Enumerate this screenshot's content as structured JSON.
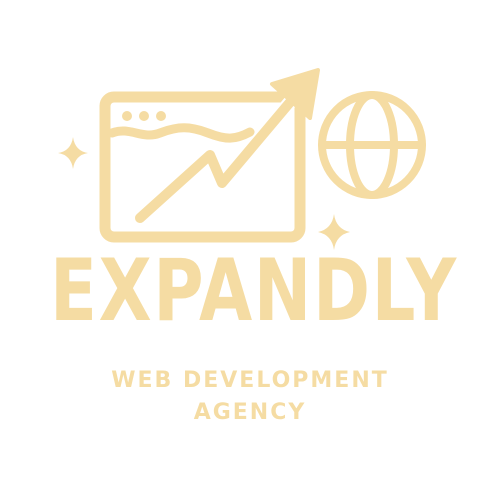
{
  "colors": {
    "logo": "#f5dca3",
    "background": "#ffffff"
  },
  "logo": {
    "icons": [
      "browser-window-icon",
      "growth-arrow-icon",
      "globe-icon",
      "sparkle-icon"
    ],
    "brand_name": "EXPANDLY",
    "tagline_line1": "WEB DEVELOPMENT",
    "tagline_line2": "AGENCY"
  }
}
